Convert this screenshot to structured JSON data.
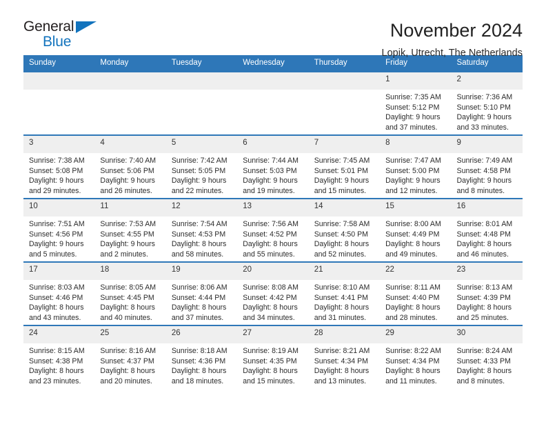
{
  "logo": {
    "word_one": "General",
    "word_two": "Blue",
    "triangle_icon": "triangle-icon",
    "brand_color": "#1273bd"
  },
  "header": {
    "title": "November 2024",
    "subtitle": "Lopik, Utrecht, The Netherlands",
    "accent_color": "#2e77b8"
  },
  "calendar": {
    "weekday_headers": [
      "Sunday",
      "Monday",
      "Tuesday",
      "Wednesday",
      "Thursday",
      "Friday",
      "Saturday"
    ],
    "weeks": [
      [
        {
          "day": "",
          "lines": []
        },
        {
          "day": "",
          "lines": []
        },
        {
          "day": "",
          "lines": []
        },
        {
          "day": "",
          "lines": []
        },
        {
          "day": "",
          "lines": []
        },
        {
          "day": "1",
          "lines": [
            "Sunrise: 7:35 AM",
            "Sunset: 5:12 PM",
            "Daylight: 9 hours",
            "and 37 minutes."
          ]
        },
        {
          "day": "2",
          "lines": [
            "Sunrise: 7:36 AM",
            "Sunset: 5:10 PM",
            "Daylight: 9 hours",
            "and 33 minutes."
          ]
        }
      ],
      [
        {
          "day": "3",
          "lines": [
            "Sunrise: 7:38 AM",
            "Sunset: 5:08 PM",
            "Daylight: 9 hours",
            "and 29 minutes."
          ]
        },
        {
          "day": "4",
          "lines": [
            "Sunrise: 7:40 AM",
            "Sunset: 5:06 PM",
            "Daylight: 9 hours",
            "and 26 minutes."
          ]
        },
        {
          "day": "5",
          "lines": [
            "Sunrise: 7:42 AM",
            "Sunset: 5:05 PM",
            "Daylight: 9 hours",
            "and 22 minutes."
          ]
        },
        {
          "day": "6",
          "lines": [
            "Sunrise: 7:44 AM",
            "Sunset: 5:03 PM",
            "Daylight: 9 hours",
            "and 19 minutes."
          ]
        },
        {
          "day": "7",
          "lines": [
            "Sunrise: 7:45 AM",
            "Sunset: 5:01 PM",
            "Daylight: 9 hours",
            "and 15 minutes."
          ]
        },
        {
          "day": "8",
          "lines": [
            "Sunrise: 7:47 AM",
            "Sunset: 5:00 PM",
            "Daylight: 9 hours",
            "and 12 minutes."
          ]
        },
        {
          "day": "9",
          "lines": [
            "Sunrise: 7:49 AM",
            "Sunset: 4:58 PM",
            "Daylight: 9 hours",
            "and 8 minutes."
          ]
        }
      ],
      [
        {
          "day": "10",
          "lines": [
            "Sunrise: 7:51 AM",
            "Sunset: 4:56 PM",
            "Daylight: 9 hours",
            "and 5 minutes."
          ]
        },
        {
          "day": "11",
          "lines": [
            "Sunrise: 7:53 AM",
            "Sunset: 4:55 PM",
            "Daylight: 9 hours",
            "and 2 minutes."
          ]
        },
        {
          "day": "12",
          "lines": [
            "Sunrise: 7:54 AM",
            "Sunset: 4:53 PM",
            "Daylight: 8 hours",
            "and 58 minutes."
          ]
        },
        {
          "day": "13",
          "lines": [
            "Sunrise: 7:56 AM",
            "Sunset: 4:52 PM",
            "Daylight: 8 hours",
            "and 55 minutes."
          ]
        },
        {
          "day": "14",
          "lines": [
            "Sunrise: 7:58 AM",
            "Sunset: 4:50 PM",
            "Daylight: 8 hours",
            "and 52 minutes."
          ]
        },
        {
          "day": "15",
          "lines": [
            "Sunrise: 8:00 AM",
            "Sunset: 4:49 PM",
            "Daylight: 8 hours",
            "and 49 minutes."
          ]
        },
        {
          "day": "16",
          "lines": [
            "Sunrise: 8:01 AM",
            "Sunset: 4:48 PM",
            "Daylight: 8 hours",
            "and 46 minutes."
          ]
        }
      ],
      [
        {
          "day": "17",
          "lines": [
            "Sunrise: 8:03 AM",
            "Sunset: 4:46 PM",
            "Daylight: 8 hours",
            "and 43 minutes."
          ]
        },
        {
          "day": "18",
          "lines": [
            "Sunrise: 8:05 AM",
            "Sunset: 4:45 PM",
            "Daylight: 8 hours",
            "and 40 minutes."
          ]
        },
        {
          "day": "19",
          "lines": [
            "Sunrise: 8:06 AM",
            "Sunset: 4:44 PM",
            "Daylight: 8 hours",
            "and 37 minutes."
          ]
        },
        {
          "day": "20",
          "lines": [
            "Sunrise: 8:08 AM",
            "Sunset: 4:42 PM",
            "Daylight: 8 hours",
            "and 34 minutes."
          ]
        },
        {
          "day": "21",
          "lines": [
            "Sunrise: 8:10 AM",
            "Sunset: 4:41 PM",
            "Daylight: 8 hours",
            "and 31 minutes."
          ]
        },
        {
          "day": "22",
          "lines": [
            "Sunrise: 8:11 AM",
            "Sunset: 4:40 PM",
            "Daylight: 8 hours",
            "and 28 minutes."
          ]
        },
        {
          "day": "23",
          "lines": [
            "Sunrise: 8:13 AM",
            "Sunset: 4:39 PM",
            "Daylight: 8 hours",
            "and 25 minutes."
          ]
        }
      ],
      [
        {
          "day": "24",
          "lines": [
            "Sunrise: 8:15 AM",
            "Sunset: 4:38 PM",
            "Daylight: 8 hours",
            "and 23 minutes."
          ]
        },
        {
          "day": "25",
          "lines": [
            "Sunrise: 8:16 AM",
            "Sunset: 4:37 PM",
            "Daylight: 8 hours",
            "and 20 minutes."
          ]
        },
        {
          "day": "26",
          "lines": [
            "Sunrise: 8:18 AM",
            "Sunset: 4:36 PM",
            "Daylight: 8 hours",
            "and 18 minutes."
          ]
        },
        {
          "day": "27",
          "lines": [
            "Sunrise: 8:19 AM",
            "Sunset: 4:35 PM",
            "Daylight: 8 hours",
            "and 15 minutes."
          ]
        },
        {
          "day": "28",
          "lines": [
            "Sunrise: 8:21 AM",
            "Sunset: 4:34 PM",
            "Daylight: 8 hours",
            "and 13 minutes."
          ]
        },
        {
          "day": "29",
          "lines": [
            "Sunrise: 8:22 AM",
            "Sunset: 4:34 PM",
            "Daylight: 8 hours",
            "and 11 minutes."
          ]
        },
        {
          "day": "30",
          "lines": [
            "Sunrise: 8:24 AM",
            "Sunset: 4:33 PM",
            "Daylight: 8 hours",
            "and 8 minutes."
          ]
        }
      ]
    ]
  }
}
